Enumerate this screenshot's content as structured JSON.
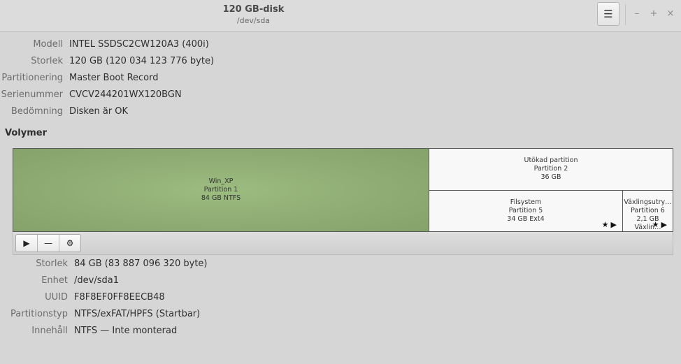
{
  "window": {
    "title": "120 GB-disk",
    "subtitle": "/dev/sda",
    "menu_icon": "hamburger-icon",
    "minimize": "–",
    "maximize": "+",
    "close": "×"
  },
  "disk_info": [
    {
      "label": "Modell",
      "value": "INTEL SSDSC2CW120A3 (400i)"
    },
    {
      "label": "Storlek",
      "value": "120 GB (120 034 123 776 byte)"
    },
    {
      "label": "Partitionering",
      "value": "Master Boot Record"
    },
    {
      "label": "Serienummer",
      "value": "CVCV244201WX120BGN"
    },
    {
      "label": "Bedömning",
      "value": "Disken är OK"
    }
  ],
  "volumes_heading": "Volymer",
  "partitions": {
    "p1": {
      "name": "Win_XP",
      "number": "Partition 1",
      "size": "84 GB NTFS",
      "color": "#8fae75"
    },
    "ext": {
      "name": "Utökad partition",
      "number": "Partition 2",
      "size": "36 GB"
    },
    "p5": {
      "name": "Filsystem",
      "number": "Partition 5",
      "size": "34 GB Ext4",
      "flags": "★▶"
    },
    "p6": {
      "name": "Växlingsutry…",
      "number": "Partition 6",
      "size": "2,1 GB Växlin…",
      "flags": "★▶"
    }
  },
  "toolbar": {
    "play": "▶",
    "minus": "—",
    "gear": "⚙"
  },
  "volume_info": [
    {
      "label": "Storlek",
      "value": "84 GB (83 887 096 320 byte)"
    },
    {
      "label": "Enhet",
      "value": "/dev/sda1"
    },
    {
      "label": "UUID",
      "value": "F8F8EF0FF8EECB48"
    },
    {
      "label": "Partitionstyp",
      "value": "NTFS/exFAT/HPFS (Startbar)"
    },
    {
      "label": "Innehåll",
      "value": "NTFS — Inte monterad"
    }
  ]
}
